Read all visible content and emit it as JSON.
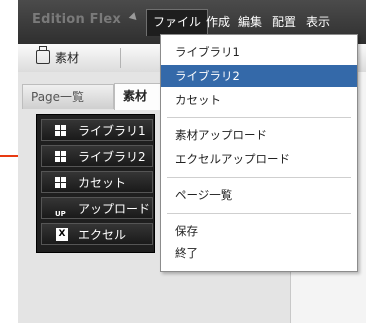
{
  "menubar": {
    "brand": "Edition Flex",
    "menus": [
      {
        "label": "ファイル"
      },
      {
        "label": "作成"
      },
      {
        "label": "編集"
      },
      {
        "label": "配置"
      },
      {
        "label": "表示"
      }
    ]
  },
  "toolbar": {
    "material_label": "素材"
  },
  "tabs": {
    "page_list": "Page一覧",
    "material": "素材"
  },
  "panel": {
    "items": [
      {
        "label": "ライブラリ1",
        "icon": "grid-icon"
      },
      {
        "label": "ライブラリ2",
        "icon": "grid-icon"
      },
      {
        "label": "カセット",
        "icon": "grid-icon"
      },
      {
        "label": "アップロード",
        "icon": "upload-icon",
        "icon_text": "UP"
      },
      {
        "label": "エクセル",
        "icon": "excel-icon",
        "icon_text": "X"
      }
    ]
  },
  "file_menu": {
    "items": [
      {
        "label": "ライブラリ1"
      },
      {
        "label": "ライブラリ2",
        "selected": true
      },
      {
        "label": "カセット"
      },
      {
        "label": "素材アップロード"
      },
      {
        "label": "エクセルアップロード"
      },
      {
        "label": "ページ一覧"
      },
      {
        "label": "保存"
      },
      {
        "label": "終了"
      }
    ]
  },
  "colors": {
    "highlight": "#3469a9",
    "arrow": "#e83a12",
    "menubar": "#3a3a3a"
  }
}
